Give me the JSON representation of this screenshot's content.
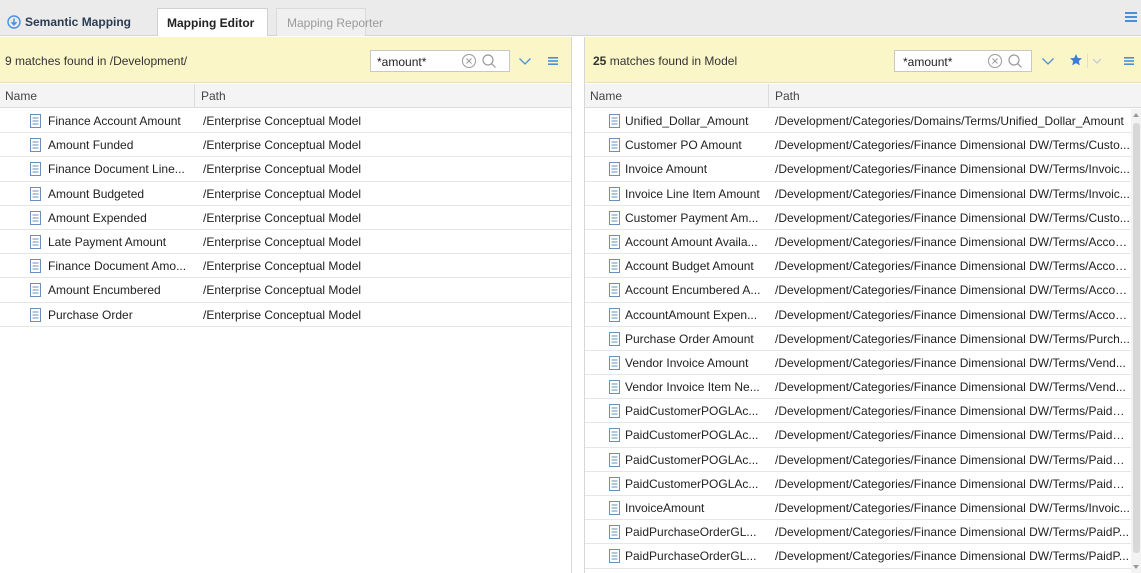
{
  "tabs": [
    {
      "label": "Semantic Mapping",
      "icon": "semantic-mapping-icon"
    },
    {
      "label": "Mapping Editor",
      "icon": null
    },
    {
      "label": "Mapping Reporter",
      "icon": null
    }
  ],
  "colors": {
    "search_bar_bg": "#fbf6c8",
    "icon_blue": "#4a90d9",
    "star_blue": "#3a7fd4",
    "tab_bar_bg": "#ebebeb"
  },
  "left": {
    "found_count": "9",
    "found_text": "matches found in /Development/",
    "search_value": "*amount*",
    "columns": {
      "name": "Name",
      "path": "Path"
    },
    "rows": [
      {
        "name": "Finance Account Amount",
        "path": "/Enterprise Conceptual Model"
      },
      {
        "name": "Amount Funded",
        "path": "/Enterprise Conceptual Model"
      },
      {
        "name": "Finance Document Line...",
        "path": "/Enterprise Conceptual Model"
      },
      {
        "name": "Amount Budgeted",
        "path": "/Enterprise Conceptual Model"
      },
      {
        "name": "Amount Expended",
        "path": "/Enterprise Conceptual Model"
      },
      {
        "name": "Late Payment Amount",
        "path": "/Enterprise Conceptual Model"
      },
      {
        "name": "Finance Document Amo...",
        "path": "/Enterprise Conceptual Model"
      },
      {
        "name": "Amount Encumbered",
        "path": "/Enterprise Conceptual Model"
      },
      {
        "name": "Purchase Order",
        "path": "/Enterprise Conceptual Model"
      }
    ]
  },
  "right": {
    "found_count": "25",
    "found_text": "matches found in Model",
    "search_value": "*amount*",
    "columns": {
      "name": "Name",
      "path": "Path"
    },
    "rows": [
      {
        "name": "Unified_Dollar_Amount",
        "path": "/Development/Categories/Domains/Terms/Unified_Dollar_Amount"
      },
      {
        "name": "Customer PO Amount",
        "path": "/Development/Categories/Finance Dimensional DW/Terms/Custo..."
      },
      {
        "name": "Invoice Amount",
        "path": "/Development/Categories/Finance Dimensional DW/Terms/Invoic..."
      },
      {
        "name": "Invoice Line Item Amount",
        "path": "/Development/Categories/Finance Dimensional DW/Terms/Invoic..."
      },
      {
        "name": "Customer Payment Am...",
        "path": "/Development/Categories/Finance Dimensional DW/Terms/Custo..."
      },
      {
        "name": "Account Amount Availa...",
        "path": "/Development/Categories/Finance Dimensional DW/Terms/Accou..."
      },
      {
        "name": "Account Budget Amount",
        "path": "/Development/Categories/Finance Dimensional DW/Terms/Accou..."
      },
      {
        "name": "Account Encumbered A...",
        "path": "/Development/Categories/Finance Dimensional DW/Terms/Accou..."
      },
      {
        "name": "AccountAmount Expen...",
        "path": "/Development/Categories/Finance Dimensional DW/Terms/Accou..."
      },
      {
        "name": "Purchase Order Amount",
        "path": "/Development/Categories/Finance Dimensional DW/Terms/Purch..."
      },
      {
        "name": "Vendor Invoice Amount",
        "path": "/Development/Categories/Finance Dimensional DW/Terms/Vend..."
      },
      {
        "name": "Vendor Invoice Item Ne...",
        "path": "/Development/Categories/Finance Dimensional DW/Terms/Vend..."
      },
      {
        "name": "PaidCustomerPOGLAc...",
        "path": "/Development/Categories/Finance Dimensional DW/Terms/PaidC..."
      },
      {
        "name": "PaidCustomerPOGLAc...",
        "path": "/Development/Categories/Finance Dimensional DW/Terms/PaidC..."
      },
      {
        "name": "PaidCustomerPOGLAc...",
        "path": "/Development/Categories/Finance Dimensional DW/Terms/PaidC..."
      },
      {
        "name": "PaidCustomerPOGLAc...",
        "path": "/Development/Categories/Finance Dimensional DW/Terms/PaidC..."
      },
      {
        "name": "InvoiceAmount",
        "path": "/Development/Categories/Finance Dimensional DW/Terms/Invoic..."
      },
      {
        "name": "PaidPurchaseOrderGL...",
        "path": "/Development/Categories/Finance Dimensional DW/Terms/PaidP..."
      },
      {
        "name": "PaidPurchaseOrderGL...",
        "path": "/Development/Categories/Finance Dimensional DW/Terms/PaidP..."
      }
    ]
  }
}
